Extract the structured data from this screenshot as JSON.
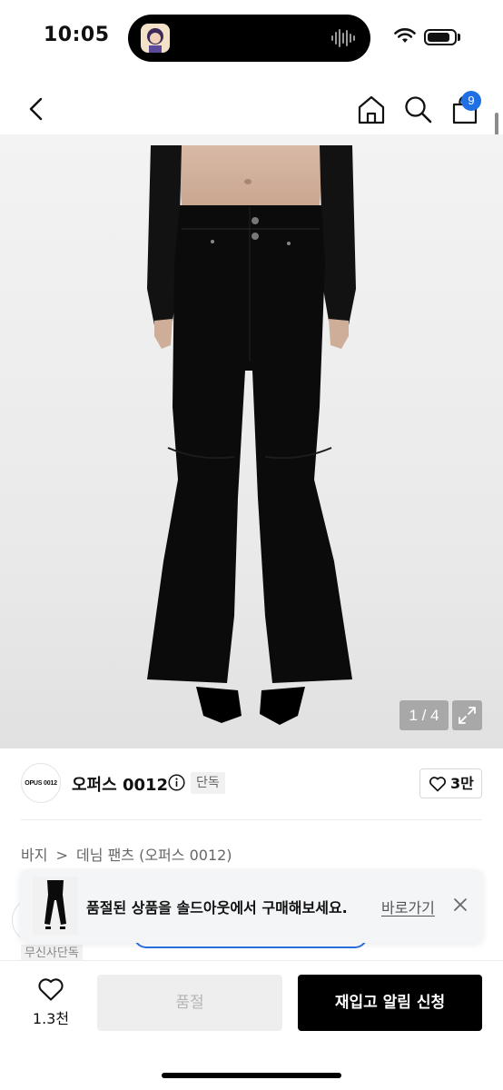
{
  "status_bar": {
    "time": "10:05"
  },
  "header": {
    "cart_badge": "9"
  },
  "product_image": {
    "pager": "1 / 4"
  },
  "brand": {
    "logo_text": "OPUS 0012",
    "name": "오퍼스 0012",
    "exclusive_tag": "단독",
    "like_count": "3만"
  },
  "breadcrumb": {
    "items": [
      "바지",
      "데님 팬츠 (오퍼스 0012)"
    ],
    "separator": ">"
  },
  "underlying": {
    "tag": "무신사단독"
  },
  "toast": {
    "message": "품절된 상품을 솔드아웃에서 구매해보세요.",
    "link": "바로가기"
  },
  "bottom_bar": {
    "wishlist_count": "1.3천",
    "soldout_label": "품절",
    "restock_label": "재입고 알림 신청"
  },
  "colors": {
    "accent_blue": "#1f6fe5",
    "primary_black": "#000000",
    "disabled_gray": "#eeeeee"
  },
  "icons": [
    "back-arrow-icon",
    "home-icon",
    "search-icon",
    "shopping-bag-icon",
    "expand-icon",
    "info-icon",
    "heart-icon",
    "close-icon"
  ]
}
